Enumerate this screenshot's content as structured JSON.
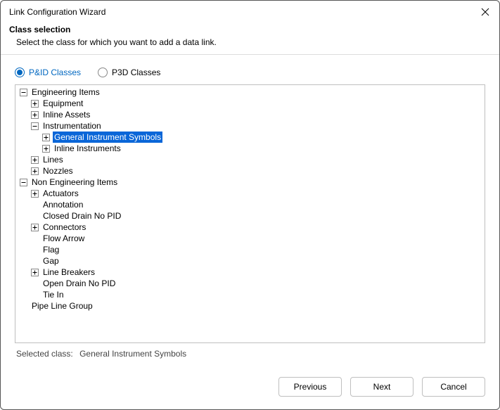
{
  "window": {
    "title": "Link Configuration Wizard"
  },
  "header": {
    "heading": "Class selection",
    "subtext": "Select the class for which you want to add a data link."
  },
  "radios": {
    "pid": "P&ID Classes",
    "p3d": "P3D Classes",
    "selected": "pid"
  },
  "tree": {
    "nodes": [
      {
        "depth": 0,
        "toggle": "minus",
        "label": "Engineering Items",
        "selected": false
      },
      {
        "depth": 1,
        "toggle": "plus",
        "label": "Equipment",
        "selected": false
      },
      {
        "depth": 1,
        "toggle": "plus",
        "label": "Inline Assets",
        "selected": false
      },
      {
        "depth": 1,
        "toggle": "minus",
        "label": "Instrumentation",
        "selected": false
      },
      {
        "depth": 2,
        "toggle": "plus",
        "label": "General Instrument Symbols",
        "selected": true
      },
      {
        "depth": 2,
        "toggle": "plus",
        "label": "Inline Instruments",
        "selected": false
      },
      {
        "depth": 1,
        "toggle": "plus",
        "label": "Lines",
        "selected": false
      },
      {
        "depth": 1,
        "toggle": "plus",
        "label": "Nozzles",
        "selected": false
      },
      {
        "depth": 0,
        "toggle": "minus",
        "label": "Non Engineering Items",
        "selected": false
      },
      {
        "depth": 1,
        "toggle": "plus",
        "label": "Actuators",
        "selected": false
      },
      {
        "depth": 1,
        "toggle": "none",
        "label": "Annotation",
        "selected": false
      },
      {
        "depth": 1,
        "toggle": "none",
        "label": "Closed Drain No PID",
        "selected": false
      },
      {
        "depth": 1,
        "toggle": "plus",
        "label": "Connectors",
        "selected": false
      },
      {
        "depth": 1,
        "toggle": "none",
        "label": "Flow Arrow",
        "selected": false
      },
      {
        "depth": 1,
        "toggle": "none",
        "label": "Flag",
        "selected": false
      },
      {
        "depth": 1,
        "toggle": "none",
        "label": "Gap",
        "selected": false
      },
      {
        "depth": 1,
        "toggle": "plus",
        "label": "Line Breakers",
        "selected": false
      },
      {
        "depth": 1,
        "toggle": "none",
        "label": "Open Drain No PID",
        "selected": false
      },
      {
        "depth": 1,
        "toggle": "none",
        "label": "Tie In",
        "selected": false
      },
      {
        "depth": 0,
        "toggle": "none",
        "label": "Pipe Line Group",
        "selected": false
      }
    ]
  },
  "selected_row": {
    "label": "Selected class:",
    "value": "General Instrument Symbols"
  },
  "buttons": {
    "previous": "Previous",
    "next": "Next",
    "cancel": "Cancel"
  }
}
